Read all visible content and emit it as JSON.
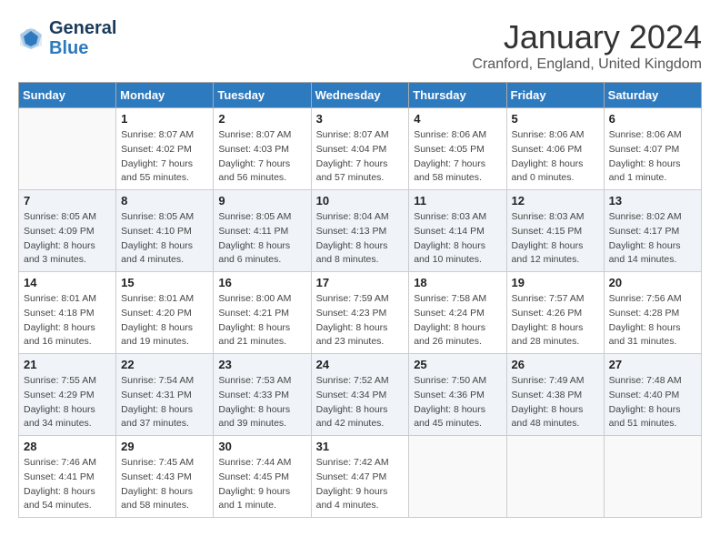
{
  "header": {
    "logo_line1": "General",
    "logo_line2": "Blue",
    "month_title": "January 2024",
    "location": "Cranford, England, United Kingdom"
  },
  "weekdays": [
    "Sunday",
    "Monday",
    "Tuesday",
    "Wednesday",
    "Thursday",
    "Friday",
    "Saturday"
  ],
  "weeks": [
    [
      {
        "day": "",
        "info": ""
      },
      {
        "day": "1",
        "info": "Sunrise: 8:07 AM\nSunset: 4:02 PM\nDaylight: 7 hours\nand 55 minutes."
      },
      {
        "day": "2",
        "info": "Sunrise: 8:07 AM\nSunset: 4:03 PM\nDaylight: 7 hours\nand 56 minutes."
      },
      {
        "day": "3",
        "info": "Sunrise: 8:07 AM\nSunset: 4:04 PM\nDaylight: 7 hours\nand 57 minutes."
      },
      {
        "day": "4",
        "info": "Sunrise: 8:06 AM\nSunset: 4:05 PM\nDaylight: 7 hours\nand 58 minutes."
      },
      {
        "day": "5",
        "info": "Sunrise: 8:06 AM\nSunset: 4:06 PM\nDaylight: 8 hours\nand 0 minutes."
      },
      {
        "day": "6",
        "info": "Sunrise: 8:06 AM\nSunset: 4:07 PM\nDaylight: 8 hours\nand 1 minute."
      }
    ],
    [
      {
        "day": "7",
        "info": "Sunrise: 8:05 AM\nSunset: 4:09 PM\nDaylight: 8 hours\nand 3 minutes."
      },
      {
        "day": "8",
        "info": "Sunrise: 8:05 AM\nSunset: 4:10 PM\nDaylight: 8 hours\nand 4 minutes."
      },
      {
        "day": "9",
        "info": "Sunrise: 8:05 AM\nSunset: 4:11 PM\nDaylight: 8 hours\nand 6 minutes."
      },
      {
        "day": "10",
        "info": "Sunrise: 8:04 AM\nSunset: 4:13 PM\nDaylight: 8 hours\nand 8 minutes."
      },
      {
        "day": "11",
        "info": "Sunrise: 8:03 AM\nSunset: 4:14 PM\nDaylight: 8 hours\nand 10 minutes."
      },
      {
        "day": "12",
        "info": "Sunrise: 8:03 AM\nSunset: 4:15 PM\nDaylight: 8 hours\nand 12 minutes."
      },
      {
        "day": "13",
        "info": "Sunrise: 8:02 AM\nSunset: 4:17 PM\nDaylight: 8 hours\nand 14 minutes."
      }
    ],
    [
      {
        "day": "14",
        "info": "Sunrise: 8:01 AM\nSunset: 4:18 PM\nDaylight: 8 hours\nand 16 minutes."
      },
      {
        "day": "15",
        "info": "Sunrise: 8:01 AM\nSunset: 4:20 PM\nDaylight: 8 hours\nand 19 minutes."
      },
      {
        "day": "16",
        "info": "Sunrise: 8:00 AM\nSunset: 4:21 PM\nDaylight: 8 hours\nand 21 minutes."
      },
      {
        "day": "17",
        "info": "Sunrise: 7:59 AM\nSunset: 4:23 PM\nDaylight: 8 hours\nand 23 minutes."
      },
      {
        "day": "18",
        "info": "Sunrise: 7:58 AM\nSunset: 4:24 PM\nDaylight: 8 hours\nand 26 minutes."
      },
      {
        "day": "19",
        "info": "Sunrise: 7:57 AM\nSunset: 4:26 PM\nDaylight: 8 hours\nand 28 minutes."
      },
      {
        "day": "20",
        "info": "Sunrise: 7:56 AM\nSunset: 4:28 PM\nDaylight: 8 hours\nand 31 minutes."
      }
    ],
    [
      {
        "day": "21",
        "info": "Sunrise: 7:55 AM\nSunset: 4:29 PM\nDaylight: 8 hours\nand 34 minutes."
      },
      {
        "day": "22",
        "info": "Sunrise: 7:54 AM\nSunset: 4:31 PM\nDaylight: 8 hours\nand 37 minutes."
      },
      {
        "day": "23",
        "info": "Sunrise: 7:53 AM\nSunset: 4:33 PM\nDaylight: 8 hours\nand 39 minutes."
      },
      {
        "day": "24",
        "info": "Sunrise: 7:52 AM\nSunset: 4:34 PM\nDaylight: 8 hours\nand 42 minutes."
      },
      {
        "day": "25",
        "info": "Sunrise: 7:50 AM\nSunset: 4:36 PM\nDaylight: 8 hours\nand 45 minutes."
      },
      {
        "day": "26",
        "info": "Sunrise: 7:49 AM\nSunset: 4:38 PM\nDaylight: 8 hours\nand 48 minutes."
      },
      {
        "day": "27",
        "info": "Sunrise: 7:48 AM\nSunset: 4:40 PM\nDaylight: 8 hours\nand 51 minutes."
      }
    ],
    [
      {
        "day": "28",
        "info": "Sunrise: 7:46 AM\nSunset: 4:41 PM\nDaylight: 8 hours\nand 54 minutes."
      },
      {
        "day": "29",
        "info": "Sunrise: 7:45 AM\nSunset: 4:43 PM\nDaylight: 8 hours\nand 58 minutes."
      },
      {
        "day": "30",
        "info": "Sunrise: 7:44 AM\nSunset: 4:45 PM\nDaylight: 9 hours\nand 1 minute."
      },
      {
        "day": "31",
        "info": "Sunrise: 7:42 AM\nSunset: 4:47 PM\nDaylight: 9 hours\nand 4 minutes."
      },
      {
        "day": "",
        "info": ""
      },
      {
        "day": "",
        "info": ""
      },
      {
        "day": "",
        "info": ""
      }
    ]
  ]
}
